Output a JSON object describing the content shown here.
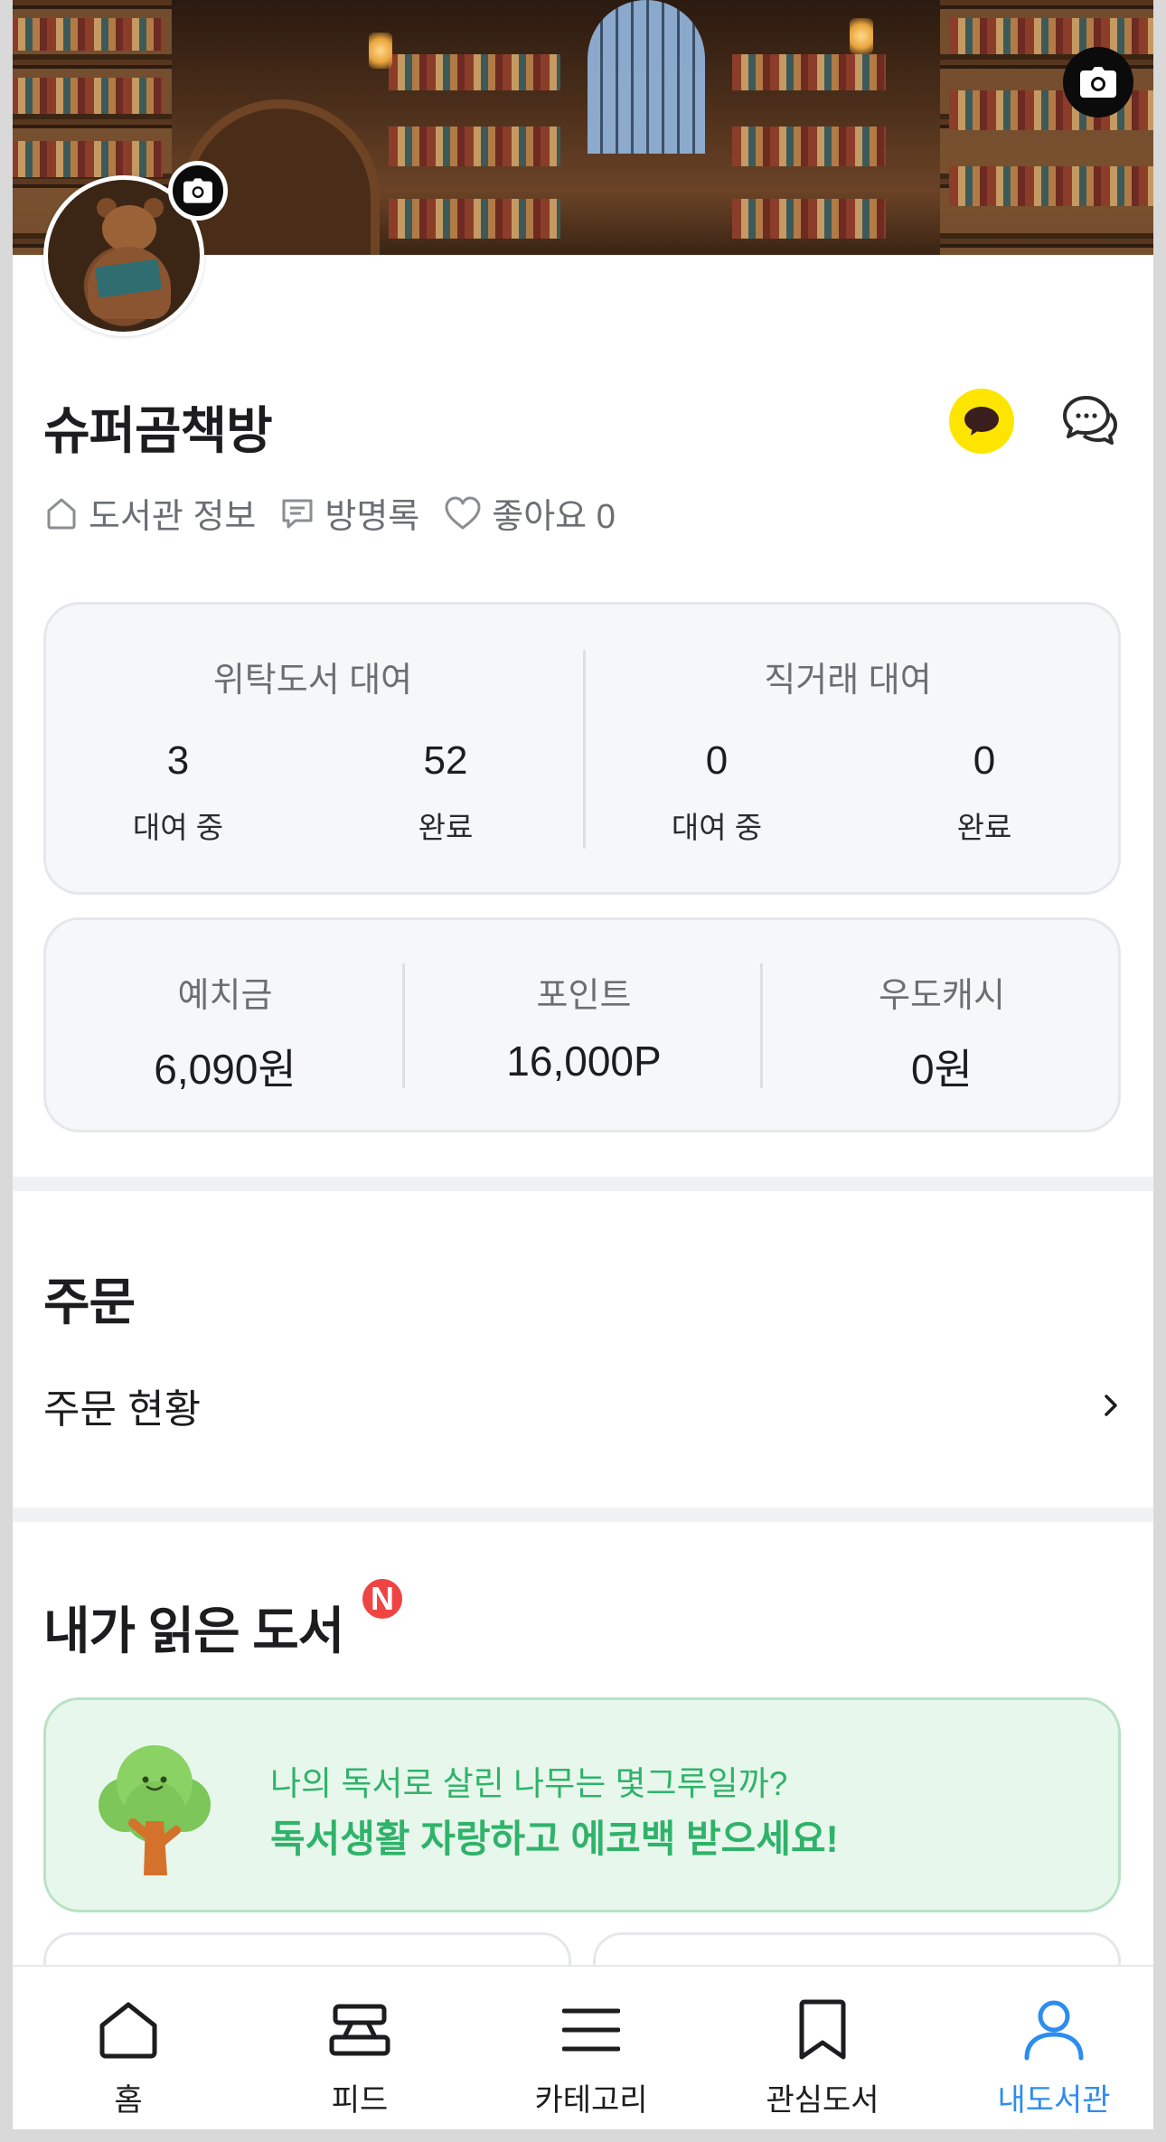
{
  "profile": {
    "name": "슈퍼곰책방",
    "links": [
      {
        "label": "도서관 정보",
        "icon": "home-outline-icon"
      },
      {
        "label": "방명록",
        "icon": "message-square-icon"
      },
      {
        "label": "좋아요 0",
        "icon": "heart-outline-icon"
      }
    ]
  },
  "rental": {
    "groups": [
      {
        "title": "위탁도서 대여",
        "stats": [
          {
            "value": "3",
            "label": "대여 중"
          },
          {
            "value": "52",
            "label": "완료"
          }
        ]
      },
      {
        "title": "직거래 대여",
        "stats": [
          {
            "value": "0",
            "label": "대여 중"
          },
          {
            "value": "0",
            "label": "완료"
          }
        ]
      }
    ]
  },
  "wallet": [
    {
      "title": "예치금",
      "value": "6,090원"
    },
    {
      "title": "포인트",
      "value": "16,000P"
    },
    {
      "title": "우도캐시",
      "value": "0원"
    }
  ],
  "orders": {
    "title": "주문",
    "row_label": "주문 현황"
  },
  "read_books": {
    "title": "내가 읽은 도서",
    "badge": "N",
    "eco_line1": "나의 독서로 살린 나무는 몇그루일까?",
    "eco_line2": "독서생활 자랑하고 에코백 받으세요!"
  },
  "tabbar": [
    {
      "label": "홈",
      "icon": "home-icon",
      "active": false
    },
    {
      "label": "피드",
      "icon": "feed-icon",
      "active": false
    },
    {
      "label": "카테고리",
      "icon": "menu-icon",
      "active": false
    },
    {
      "label": "관심도서",
      "icon": "bookmark-icon",
      "active": false
    },
    {
      "label": "내도서관",
      "icon": "user-icon",
      "active": true
    }
  ],
  "colors": {
    "accent": "#2d8cf0",
    "kakao": "#fee500",
    "eco_green": "#2fb36a",
    "badge_red": "#ef4444"
  }
}
